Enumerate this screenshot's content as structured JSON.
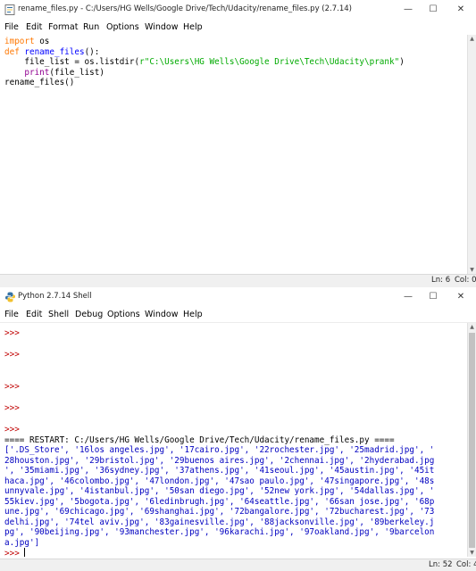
{
  "editor_window": {
    "title": "rename_files.py - C:/Users/HG Wells/Google Drive/Tech/Udacity/rename_files.py (2.7.14)",
    "controls": {
      "minimize": "—",
      "maximize": "☐",
      "close": "✕"
    },
    "menu": [
      "File",
      "Edit",
      "Format",
      "Run",
      "Options",
      "Window",
      "Help"
    ],
    "code": {
      "l1_kw": "import",
      "l1_rest": " os",
      "l2_kw": "def",
      "l2_name": " rename_files",
      "l2_rest": "():",
      "l3_a": "    file_list = os.listdir(",
      "l3_str": "r\"C:\\Users\\HG Wells\\Google Drive\\Tech\\Udacity\\prank\"",
      "l3_b": ")",
      "l4_indent": "    ",
      "l4_kw": "print",
      "l4_rest": "(file_list)",
      "l5": "rename_files()"
    },
    "status": {
      "line": "Ln: 6",
      "col": "Col: 0"
    }
  },
  "shell_window": {
    "title": "Python 2.7.14 Shell",
    "controls": {
      "minimize": "—",
      "maximize": "☐",
      "close": "✕"
    },
    "menu": [
      "File",
      "Edit",
      "Shell",
      "Debug",
      "Options",
      "Window",
      "Help"
    ],
    "prompt": ">>>",
    "restart_line": "==== RESTART: C:/Users/HG Wells/Google Drive/Tech/Udacity/rename_files.py ====",
    "output_lines": [
      "['.DS_Store', '16los angeles.jpg', '17cairo.jpg', '22rochester.jpg', '25madrid.jpg', '",
      "28houston.jpg', '29bristol.jpg', '29buenos aires.jpg', '2chennai.jpg', '2hyderabad.jpg",
      "', '35miami.jpg', '36sydney.jpg', '37athens.jpg', '41seoul.jpg', '45austin.jpg', '45it",
      "haca.jpg', '46colombo.jpg', '47london.jpg', '47sao paulo.jpg', '47singapore.jpg', '48s",
      "unnyvale.jpg', '4istanbul.jpg', '50san diego.jpg', '52new york.jpg', '54dallas.jpg', '",
      "55kiev.jpg', '5bogota.jpg', '6ledinbrugh.jpg', '64seattle.jpg', '66san jose.jpg', '68p",
      "une.jpg', '69chicago.jpg', '69shanghai.jpg', '72bangalore.jpg', '72bucharest.jpg', '73",
      "delhi.jpg', '74tel aviv.jpg', '83gainesville.jpg', '88jacksonville.jpg', '89berkeley.j",
      "pg', '90beijing.jpg', '93manchester.jpg', '96karachi.jpg', '97oakland.jpg', '9barcelon",
      "a.jpg']"
    ],
    "status": {
      "line": "Ln: 52",
      "col": "Col: 4"
    }
  }
}
